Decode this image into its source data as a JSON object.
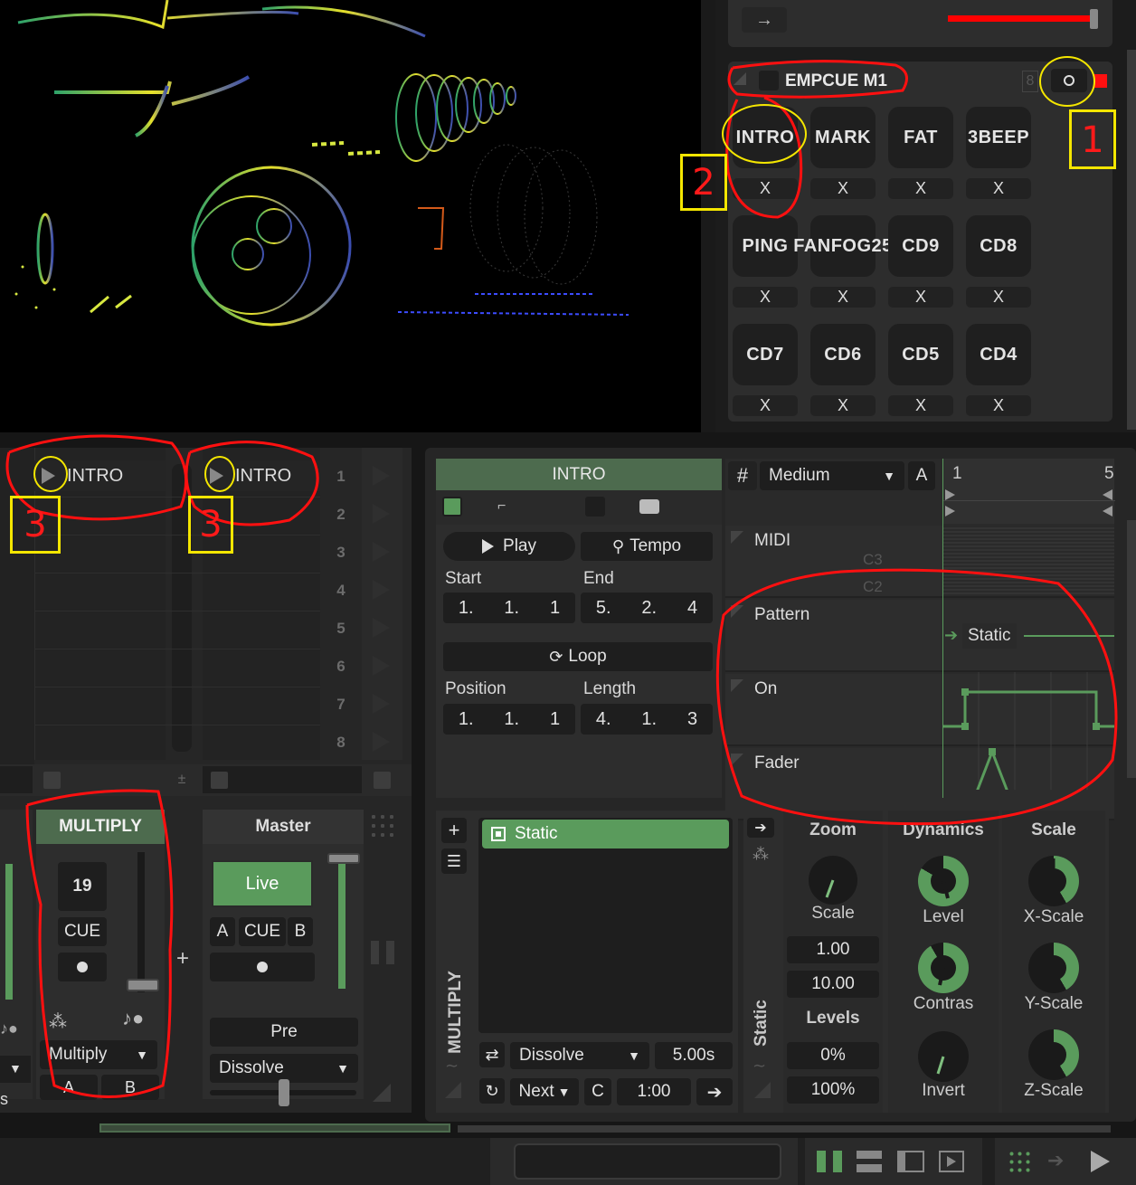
{
  "transport": {
    "arrow_icon": "arrow-right-icon",
    "accent": "#ff0000"
  },
  "cue_panel": {
    "title": "EMPCUE M1",
    "badge": "8",
    "rows": [
      [
        {
          "label": "INTRO",
          "x": "X"
        },
        {
          "label": "MARK",
          "x": "X"
        },
        {
          "label": "FAT",
          "x": "X"
        },
        {
          "label": "3BEEP",
          "x": "X"
        }
      ],
      [
        {
          "label": "PING",
          "x": "X"
        },
        {
          "label": "FANFOG25",
          "x": "X"
        },
        {
          "label": "CD9",
          "x": "X"
        },
        {
          "label": "CD8",
          "x": "X"
        }
      ],
      [
        {
          "label": "CD7",
          "x": "X"
        },
        {
          "label": "CD6",
          "x": "X"
        },
        {
          "label": "CD5",
          "x": "X"
        },
        {
          "label": "CD4",
          "x": "X"
        }
      ]
    ]
  },
  "annotations": {
    "a1": "1",
    "a2": "2",
    "a3a": "3",
    "a3b": "3",
    "ink": "#ff1010",
    "box": "#f4e600"
  },
  "deck": {
    "slot_a": "INTRO",
    "slot_b": "INTRO",
    "numbers": [
      "1",
      "2",
      "3",
      "4",
      "5",
      "6",
      "7",
      "8"
    ]
  },
  "mixer": {
    "channel_name": "MULTIPLY",
    "channel_value": "19",
    "cue": "CUE",
    "mode": "Multiply",
    "a": "A",
    "b": "B",
    "s_letter": "s",
    "plus": "+",
    "master_title": "Master",
    "live": "Live",
    "master_a": "A",
    "master_cue": "CUE",
    "master_b": "B",
    "pre": "Pre",
    "dissolve": "Dissolve"
  },
  "clip": {
    "name": "INTRO",
    "play": "Play",
    "tempo": "Tempo",
    "start_label": "Start",
    "end_label": "End",
    "start": [
      "1.",
      "1.",
      "1"
    ],
    "end": [
      "5.",
      "2.",
      "4"
    ],
    "loop": "Loop",
    "position_label": "Position",
    "length_label": "Length",
    "position": [
      "1.",
      "1.",
      "1"
    ],
    "length": [
      "4.",
      "1.",
      "3"
    ]
  },
  "timeline": {
    "grid": "Medium",
    "a": "A",
    "bar_start": "1",
    "bar_end": "5",
    "lanes": [
      "MIDI",
      "Pattern",
      "On",
      "Fader"
    ],
    "c3": "C3",
    "c2": "C2",
    "pattern_value": "Static"
  },
  "effect": {
    "side_label": "MULTIPLY",
    "item": "Static",
    "transition": "Dissolve",
    "duration": "5.00s",
    "next": "Next",
    "c": "C",
    "time": "1:00",
    "vertical_label": "Static"
  },
  "params": {
    "zoom": "Zoom",
    "zoom_knob": "Scale",
    "zoom_v1": "1.00",
    "zoom_v2": "10.00",
    "levels": "Levels",
    "levels_v1": "0%",
    "levels_v2": "100%",
    "dynamics": "Dynamics",
    "level": "Level",
    "contrast": "Contras",
    "invert": "Invert",
    "scale": "Scale",
    "xscale": "X-Scale",
    "yscale": "Y-Scale",
    "zscale": "Z-Scale"
  }
}
